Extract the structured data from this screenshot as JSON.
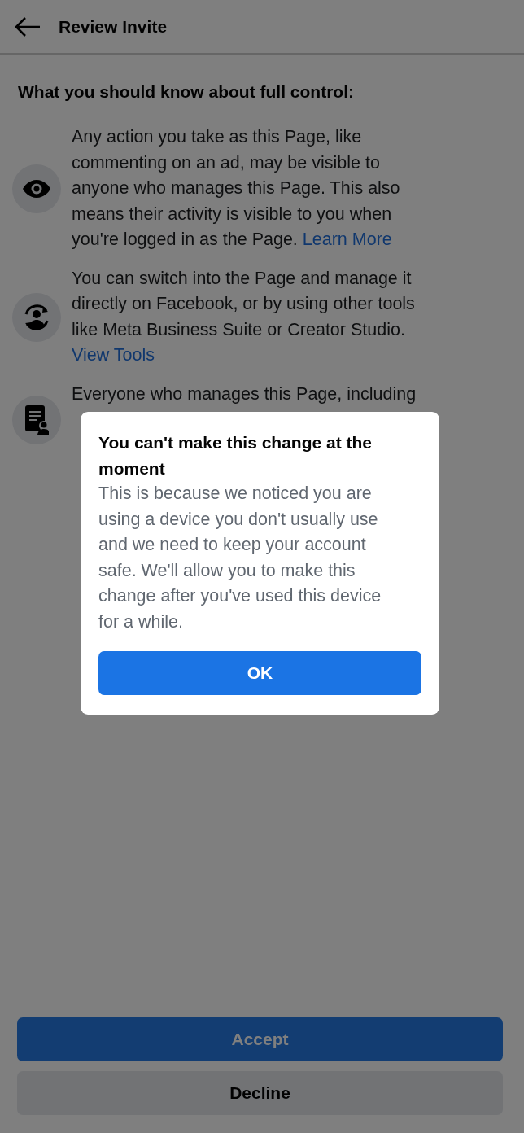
{
  "header": {
    "title": "Review Invite"
  },
  "heading": "What you should know about full control:",
  "items": [
    {
      "kind": "eye",
      "text": "Any action you take as this Page, like commenting on an ad, may be visible to anyone who manages this Page. This also means their activity is visible to you when you're logged in as the Page.",
      "link": "Learn More"
    },
    {
      "kind": "switch",
      "text": "You can switch into the Page and manage it directly on Facebook, or by using other tools like Meta Business Suite or Creator Studio.",
      "link": "View Tools"
    },
    {
      "kind": "document",
      "lines": [
        "Everyone who manages this Page, including"
      ]
    }
  ],
  "buttons": {
    "accept": "Accept",
    "decline": "Decline"
  },
  "dialog": {
    "title": "You can't make this change at the moment",
    "body": "This is because we noticed you are using a device you don't usually use and we need to keep your account safe. We'll allow you to make this change after you've used this device for a while.",
    "button": "OK"
  }
}
